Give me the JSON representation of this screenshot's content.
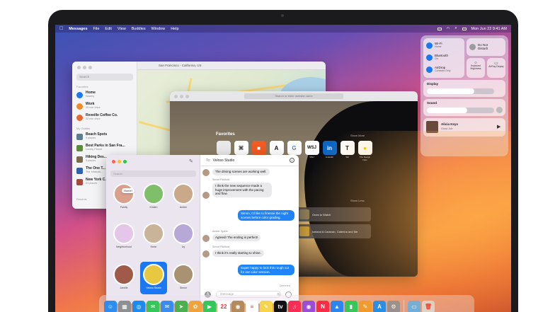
{
  "menubar": {
    "apple": "",
    "app_name": "Messages",
    "items": [
      "File",
      "Edit",
      "View",
      "Buddies",
      "Window",
      "Help"
    ],
    "date_time": "Mon Jun 22  9:41 AM"
  },
  "maps": {
    "window_title": "San Francisco - California, US",
    "search_placeholder": "Search",
    "favorites_header": "Favorites",
    "favorites": [
      {
        "label": "Home",
        "sub": "Nearby",
        "color": "#1a78f2"
      },
      {
        "label": "Work",
        "sub": "20 min drive",
        "color": "#f08a2a"
      },
      {
        "label": "Reveille Coffee Co.",
        "sub": "22 min drive",
        "color": "#e8692f"
      }
    ],
    "guides_header": "My Guides",
    "guides": [
      {
        "label": "Beach Spots",
        "sub": "9 places",
        "color": "#5a7d8f"
      },
      {
        "label": "Best Parks in San Fra...",
        "sub": "Lonely Planet",
        "color": "#5b8a3d"
      },
      {
        "label": "Hiking Des...",
        "sub": "5 places",
        "color": "#7a6a50"
      },
      {
        "label": "The One T...",
        "sub": "The Infatuati...",
        "color": "#3060b0"
      },
      {
        "label": "New York C...",
        "sub": "23 places",
        "color": "#a84a3a"
      }
    ],
    "recents_header": "Recents"
  },
  "safari": {
    "url_placeholder": "Search or enter website name",
    "favorites_title": "Favorites",
    "show_more": "Show More",
    "show_less": "Show Less",
    "favorites": [
      {
        "glyph": "",
        "name": "Apple"
      },
      {
        "glyph": "⌘",
        "name": "It's Nice That"
      },
      {
        "glyph": "■",
        "name": "Patchwork Architecture"
      },
      {
        "glyph": "A",
        "name": "Ace Hotel"
      },
      {
        "glyph": "G",
        "name": "Google"
      },
      {
        "glyph": "WSJ",
        "name": "WSJ"
      },
      {
        "glyph": "in",
        "name": "LinkedIn"
      },
      {
        "glyph": "T",
        "name": "Tait"
      },
      {
        "glyph": "●",
        "name": "The Design Files"
      }
    ],
    "reading": [
      {
        "text": "Ones to Watch"
      },
      {
        "text": "Iceland A Caravan, Caterina and Me"
      }
    ]
  },
  "messages": {
    "search_placeholder": "Search",
    "to_label": "To:",
    "recipient": "Veloso Studio",
    "home_badge": "Home!",
    "contacts": [
      {
        "name": "Family",
        "color": "#d9a08b"
      },
      {
        "name": "Kristen",
        "color": "#7fbf6a"
      },
      {
        "name": "Amber",
        "color": "#c9a98a"
      },
      {
        "name": "Neighborhood",
        "color": "#e3c6e8"
      },
      {
        "name": "Kevin",
        "color": "#c9b49a"
      },
      {
        "name": "Ivy",
        "color": "#b7a8d8"
      },
      {
        "name": "Janelle",
        "color": "#a05a4a"
      },
      {
        "name": "Veloso Studio",
        "color": "#e8c840"
      },
      {
        "name": "Simon",
        "color": "#a89272"
      }
    ],
    "thread": [
      {
        "dir": "in",
        "sender": "",
        "text": "The driving scenes are working well."
      },
      {
        "dir": "in",
        "sender": "Simon Pickford",
        "text": "I think the new sequence made a huge improvement with the pacing and flow."
      },
      {
        "dir": "out",
        "sender": "",
        "text": "Simon, I'd like to finesse the night scenes before color grading."
      },
      {
        "dir": "in",
        "sender": "Amber Spiers",
        "text": "Agreed! The ending is perfect!"
      },
      {
        "dir": "in",
        "sender": "Simon Pickford",
        "text": "I think it's really starting to shine."
      },
      {
        "dir": "out",
        "sender": "",
        "text": "Super happy to lock this rough cut for our color session."
      }
    ],
    "delivered": "Delivered",
    "input_placeholder": "iMessage"
  },
  "control_center": {
    "wifi": {
      "label": "Wi-Fi",
      "sub": "Home"
    },
    "bluetooth": {
      "label": "Bluetooth",
      "sub": "On"
    },
    "airdrop": {
      "label": "AirDrop",
      "sub": "Contacts Only"
    },
    "dnd": {
      "label": "Do Not Disturb"
    },
    "keyboard": {
      "label": "Keyboard Brightness"
    },
    "airplay": {
      "label": "AirPlay Display"
    },
    "display_label": "Display",
    "display_level": 0.7,
    "sound_label": "Sound",
    "sound_level": 0.6,
    "now_playing": {
      "title": "Alicia Keys",
      "sub": "Good Job"
    }
  },
  "dock": [
    {
      "name": "finder",
      "color": "#2d8cf0",
      "glyph": "☺"
    },
    {
      "name": "launchpad",
      "color": "#8e8e93",
      "glyph": "▦"
    },
    {
      "name": "safari",
      "color": "#1a8cf0",
      "glyph": "◎"
    },
    {
      "name": "messages",
      "color": "#35c759",
      "glyph": "✉"
    },
    {
      "name": "mail",
      "color": "#3a8cf0",
      "glyph": "✉"
    },
    {
      "name": "maps",
      "color": "#4caf50",
      "glyph": "➤"
    },
    {
      "name": "photos",
      "color": "#f2a23a",
      "glyph": "✿"
    },
    {
      "name": "facetime",
      "color": "#34c759",
      "glyph": "▶"
    },
    {
      "name": "calendar",
      "color": "#ffffff",
      "glyph": "22"
    },
    {
      "name": "contacts",
      "color": "#b38a5a",
      "glyph": "◉"
    },
    {
      "name": "reminders",
      "color": "#ffffff",
      "glyph": "≡"
    },
    {
      "name": "notes",
      "color": "#f7d54a",
      "glyph": "✎"
    },
    {
      "name": "tv",
      "color": "#111111",
      "glyph": "tv"
    },
    {
      "name": "music",
      "color": "#fa2d55",
      "glyph": "♫"
    },
    {
      "name": "podcasts",
      "color": "#9b4dd9",
      "glyph": "◉"
    },
    {
      "name": "news",
      "color": "#fa2d48",
      "glyph": "N"
    },
    {
      "name": "keynote",
      "color": "#2c86f0",
      "glyph": "▲"
    },
    {
      "name": "numbers",
      "color": "#34c759",
      "glyph": "▮"
    },
    {
      "name": "pages",
      "color": "#f09a2a",
      "glyph": "✎"
    },
    {
      "name": "app-store",
      "color": "#1a8cf0",
      "glyph": "A"
    },
    {
      "name": "system-preferences",
      "color": "#8e8e93",
      "glyph": "⚙"
    },
    {
      "name": "downloads-folder",
      "color": "#5ab0f0",
      "glyph": "▭"
    },
    {
      "name": "trash",
      "color": "#d8d8dc",
      "glyph": "🗑"
    }
  ]
}
